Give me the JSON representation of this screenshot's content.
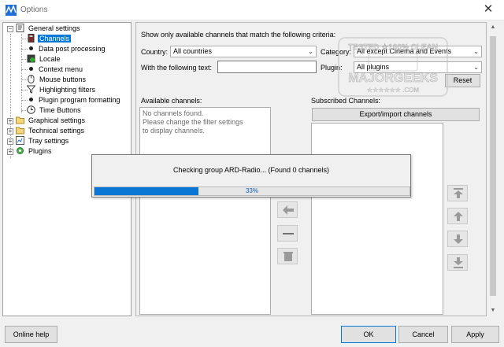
{
  "window": {
    "title": "Options",
    "close_glyph": "✕",
    "icon": "app-logo-icon"
  },
  "tree": {
    "items": [
      {
        "label": "General settings",
        "icon": "settings-doc-icon",
        "expander": "−"
      },
      {
        "label": "Channels",
        "icon": "channels-icon",
        "selected": true
      },
      {
        "label": "Data post processing",
        "icon": "bullet"
      },
      {
        "label": "Locale",
        "icon": "locale-icon"
      },
      {
        "label": "Context menu",
        "icon": "bullet"
      },
      {
        "label": "Mouse buttons",
        "icon": "mouse-icon"
      },
      {
        "label": "Highlighting filters",
        "icon": "filter-icon"
      },
      {
        "label": "Plugin program formatting",
        "icon": "bullet"
      },
      {
        "label": "Time Buttons",
        "icon": "clock-icon"
      },
      {
        "label": "Graphical settings",
        "icon": "folder-icon",
        "expander": "+"
      },
      {
        "label": "Technical settings",
        "icon": "folder-icon",
        "expander": "+"
      },
      {
        "label": "Tray settings",
        "icon": "tray-icon",
        "expander": "+"
      },
      {
        "label": "Plugins",
        "icon": "plugin-icon",
        "expander": "+"
      }
    ]
  },
  "filter": {
    "heading": "Show only available channels that match the following criteria:",
    "country_label": "Country:",
    "country_value": "All countries",
    "category_label": "Category:",
    "category_value": "All except Cinema and Events",
    "text_label": "With the following text:",
    "text_value": "",
    "plugin_label": "Plugin:",
    "plugin_value": "All plugins",
    "reset_label": "Reset"
  },
  "available": {
    "label": "Available channels:",
    "lines": [
      "No channels found.",
      "Please change the filter settings",
      "to display channels."
    ]
  },
  "subscribed": {
    "label": "Subscribed Channels:",
    "export_label": "Export/import channels"
  },
  "progress": {
    "message": "Checking group ARD-Radio... (Found 0 channels)",
    "percent_text": "33%",
    "fraction": 0.33
  },
  "watermark": {
    "line1": "TESTED ★100% CLEAN",
    "line2": "MAJORGEEKS",
    "line3": "★★★★★★ .COM"
  },
  "footer": {
    "help_label": "Online help",
    "ok_label": "OK",
    "cancel_label": "Cancel",
    "apply_label": "Apply"
  },
  "colors": {
    "accent": "#0078d7",
    "progress": "#0a77d5"
  }
}
